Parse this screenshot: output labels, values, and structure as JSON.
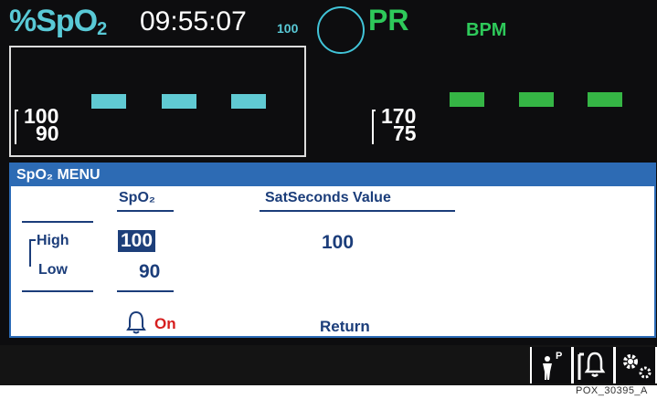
{
  "header": {
    "spo2_label": "%SpO",
    "spo2_sub": "2",
    "time": "09:55:07",
    "sat_small": "100",
    "pr_label": "PR",
    "bpm_label": "BPM"
  },
  "spo2_panel": {
    "limit_high": "100",
    "limit_low": "90"
  },
  "pr_panel": {
    "limit_high": "170",
    "limit_low": "75"
  },
  "menu": {
    "title": "SpO₂  MENU",
    "column_spo2": "SpO₂",
    "column_satseconds": "SatSeconds Value",
    "row_high": "High",
    "row_low": "Low",
    "spo2_high_value": "100",
    "spo2_low_value": "90",
    "satseconds_value": "100",
    "alarm_state": "On",
    "return_label": "Return"
  },
  "bottom_bar": {
    "icons": [
      "patient-icon",
      "alarm-silence-icon",
      "settings-icon"
    ],
    "patient_mode": "P"
  },
  "caption": "POX_30395_A",
  "colors": {
    "spo2_cyan": "#59c9d6",
    "pr_green": "#2ec95a",
    "menu_blue": "#2d6bb4",
    "alarm_red": "#d61e1e"
  }
}
